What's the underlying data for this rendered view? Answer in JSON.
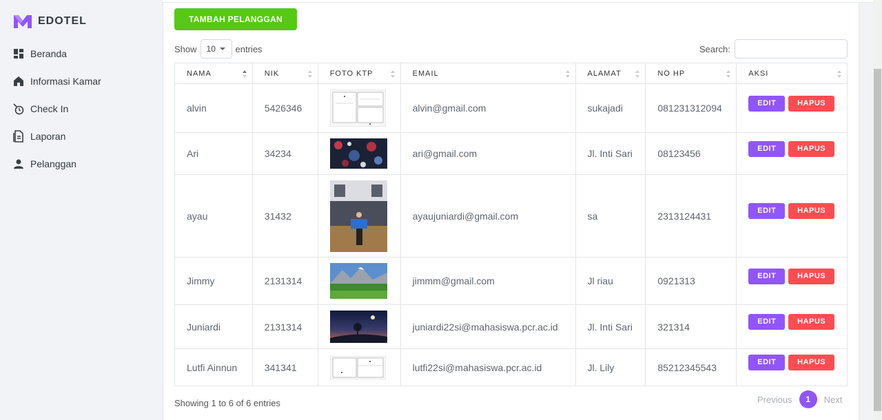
{
  "app": {
    "brand": "EDOTEL"
  },
  "sidebar": {
    "items": [
      {
        "label": "Beranda",
        "icon": "dashboard-icon"
      },
      {
        "label": "Informasi Kamar",
        "icon": "home-icon"
      },
      {
        "label": "Check In",
        "icon": "clock-icon"
      },
      {
        "label": "Laporan",
        "icon": "document-icon"
      },
      {
        "label": "Pelanggan",
        "icon": "user-icon"
      }
    ]
  },
  "toolbar": {
    "add_label": "TAMBAH PELANGGAN",
    "show_label": "Show",
    "entries_label": "entries",
    "length_value": "10",
    "search_label": "Search:"
  },
  "table": {
    "headers": [
      "NAMA",
      "NIK",
      "FOTO KTP",
      "EMAIL",
      "ALAMAT",
      "NO HP",
      "AKSI"
    ],
    "rows": [
      {
        "nama": "alvin",
        "nik": "5426346",
        "email": "alvin@gmail.com",
        "alamat": "sukajadi",
        "no_hp": "081231312094",
        "photo": "document-scan"
      },
      {
        "nama": "Ari",
        "nik": "34234",
        "email": "ari@gmail.com",
        "alamat": "Jl. Inti Sari",
        "no_hp": "08123456",
        "photo": "abstract-pattern"
      },
      {
        "nama": "ayau",
        "nik": "31432",
        "email": "ayaujuniardi@gmail.com",
        "alamat": "sa",
        "no_hp": "2313124431",
        "photo": "person-in-gym"
      },
      {
        "nama": "Jimmy",
        "nik": "2131314",
        "email": "jimmm@gmail.com",
        "alamat": "Jl riau",
        "no_hp": "0921313",
        "photo": "mountain-landscape"
      },
      {
        "nama": "Juniardi",
        "nik": "2131314",
        "email": "juniardi22si@mahasiswa.pcr.ac.id",
        "alamat": "Jl. Inti Sari",
        "no_hp": "321314",
        "photo": "night-tree"
      },
      {
        "nama": "Lutfi Ainnun",
        "nik": "341341",
        "email": "lutfi22si@mahasiswa.pcr.ac.id",
        "alamat": "Jl. Lily",
        "no_hp": "85212345543",
        "photo": "document-scan"
      }
    ],
    "edit_label": "EDIT",
    "delete_label": "HAPUS"
  },
  "footer": {
    "info": "Showing 1 to 6 of 6 entries",
    "previous": "Previous",
    "page": "1",
    "next": "Next"
  },
  "colors": {
    "primary": "#9155fd",
    "danger": "#ff4c51",
    "success": "#56c815"
  }
}
